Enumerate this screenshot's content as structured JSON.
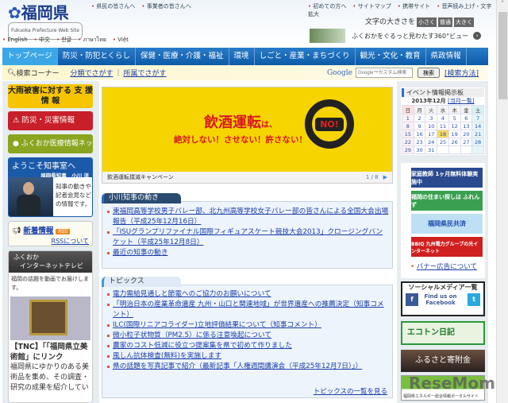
{
  "header": {
    "logo": "福岡県",
    "logo_sub": "Fukuoka Prefecture Web Site",
    "top_links_left": [
      "県民の皆さんへ",
      "事業者の皆さんへ"
    ],
    "top_links_right": [
      "初めての方へ",
      "サイトマップ",
      "携帯サイト",
      "音声読み上げ・文字拡大"
    ],
    "font_size_label": "文字の大きさを",
    "font_sizes": [
      "小さく",
      "普通",
      "大きく"
    ],
    "languages": [
      "English",
      "中文",
      "한글",
      "ภาษาไทย",
      "Việt"
    ],
    "vr_link": "ふくおかをぐるっと見わたす360°ビュー"
  },
  "nav": [
    "トップページ",
    "防災・防犯とくらし",
    "保健・医療・介護・福祉",
    "環境",
    "しごと・産業・まちづくり",
    "観光・文化・教育",
    "県政情報"
  ],
  "search": {
    "label": "検索コーナー",
    "by_category": "分類でさがす",
    "by_dept": "所属でさがす",
    "google": "Google",
    "placeholder": "Google™カスタム検索",
    "button": "検索",
    "help": "[検索方法]"
  },
  "left": {
    "support": "大雨被害に対する 支 援 情 報",
    "disaster": "防災・災害情報",
    "medical": "ふくおか医療情報ネット",
    "governor_title": "ようこそ知事室へ",
    "governor_name": "福岡県知事　小川 洋",
    "governor_desc": "知事の動きや記者会見などの情報です。",
    "news": "新着情報",
    "rss_badge": "RSS",
    "rss_about": "RSSについて",
    "tv_title1": "ふくおか",
    "tv_title2": "インターネットテレビ",
    "tv_desc": "福岡の話題を動画でお届けします。",
    "tv_item_title": "【TNC】「「福岡県立美術館」にリンク",
    "tv_item_desc": "福岡県にゆかりのある美術品を集め、その調査・研究の成果を紹介してい"
  },
  "banner": {
    "line1": "飲酒運転",
    "line1b": "は、",
    "line2": "絶対しない！させない！許さない！",
    "no": "NO!",
    "caption": "飲酒運転撲滅キャンペーン",
    "page": "1 / 8"
  },
  "governor_section": {
    "title": "小川知事の動き",
    "items": [
      "東福岡高等学校男子バレー部、北九州高等学校女子バレー部の皆さんによる全国大会出場報告（平成25年12月16日）",
      "「ISUグランプリファイナル国際フィギュアスケート競技大会2013」クロージングバンケット（平成25年12月8日）",
      "最近の知事の動き"
    ]
  },
  "topics": {
    "title": "トピックス",
    "items": [
      "電力需給見通しと節電へのご協力のお願いについて",
      "「明治日本の産業革命遺産 九州・山口と関連地域」が世界遺産への推薦決定（知事コメント）",
      "ILC(国際リニアコライダー)立地評価結果について（知事コメント）",
      "微小粒子状物質（PM2.5）に係る注意喚起について",
      "農家のコスト低減に役立つ提案集を県で初めて作りました",
      "風しん抗体検査(無料)を実施します",
      "県の話題を写真記事で紹介（最新記事「人権週間講演会（平成25年12月7日）」）"
    ],
    "more": "トピックスの一覧を見る"
  },
  "right": {
    "events_title": "イベント情報掲示板",
    "cal_month": "2013年12月",
    "cal_list": "[当月一覧]",
    "weekdays": [
      "日",
      "月",
      "火",
      "水",
      "木",
      "金",
      "土"
    ],
    "days": [
      [
        "1",
        "2",
        "3",
        "4",
        "5",
        "6",
        "7"
      ],
      [
        "8",
        "9",
        "10",
        "11",
        "12",
        "13",
        "14"
      ],
      [
        "15",
        "16",
        "17",
        "18",
        "19",
        "20",
        "21"
      ],
      [
        "22",
        "23",
        "24",
        "25",
        "26",
        "27",
        "28"
      ],
      [
        "29",
        "30",
        "31",
        "",
        "",
        "",
        ""
      ]
    ],
    "today": "18",
    "ads": [
      "家庭教師 1ヶ月無料体験実施中",
      "福岡の住まい探しは ふれんず",
      "福岡県民共済",
      "BBIQ 九州電力グループの光インターネット"
    ],
    "ad_about": "バナー広告について",
    "social_title": "ソーシャルメディア一覧",
    "facebook": "Find us on Facebook",
    "ecoton": "エコトン日記",
    "furusato": "ふるさと寄附金",
    "energy": "福岡県エネルギー総合情報ポータルサイト"
  },
  "watermark": "ReseMom"
}
